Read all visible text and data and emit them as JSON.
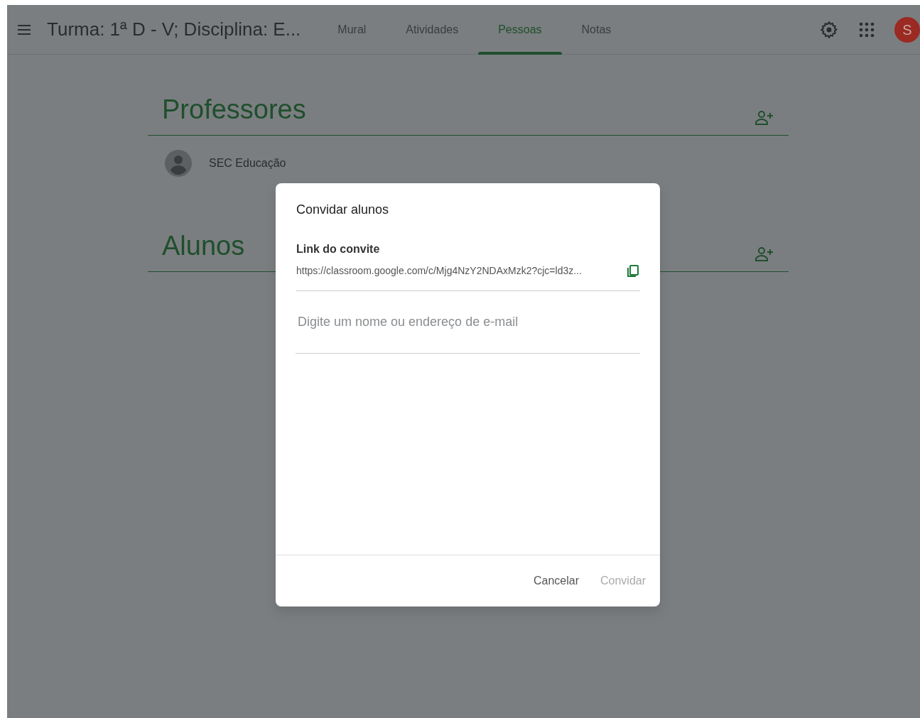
{
  "header": {
    "title": "Turma: 1ª D - V; Disciplina: E...",
    "tabs": [
      {
        "label": "Mural",
        "selected": false
      },
      {
        "label": "Atividades",
        "selected": false
      },
      {
        "label": "Pessoas",
        "selected": true
      },
      {
        "label": "Notas",
        "selected": false
      }
    ],
    "account_initial": "S"
  },
  "sections": [
    {
      "title": "Professores",
      "people": [
        {
          "name": "SEC Educação"
        }
      ]
    },
    {
      "title": "Alunos"
    }
  ],
  "dialog": {
    "title": "Convidar alunos",
    "link_label": "Link do convite",
    "link": "https://classroom.google.com/c/Mjg4NzY2NDAxMzk2?cjc=ld3z...",
    "email_field": {
      "placeholder": "Digite um nome ou endereço de e-mail"
    },
    "buttons": [
      {
        "label": "Cancelar",
        "disabled": false
      },
      {
        "label": "Convidar",
        "disabled": true
      }
    ]
  }
}
